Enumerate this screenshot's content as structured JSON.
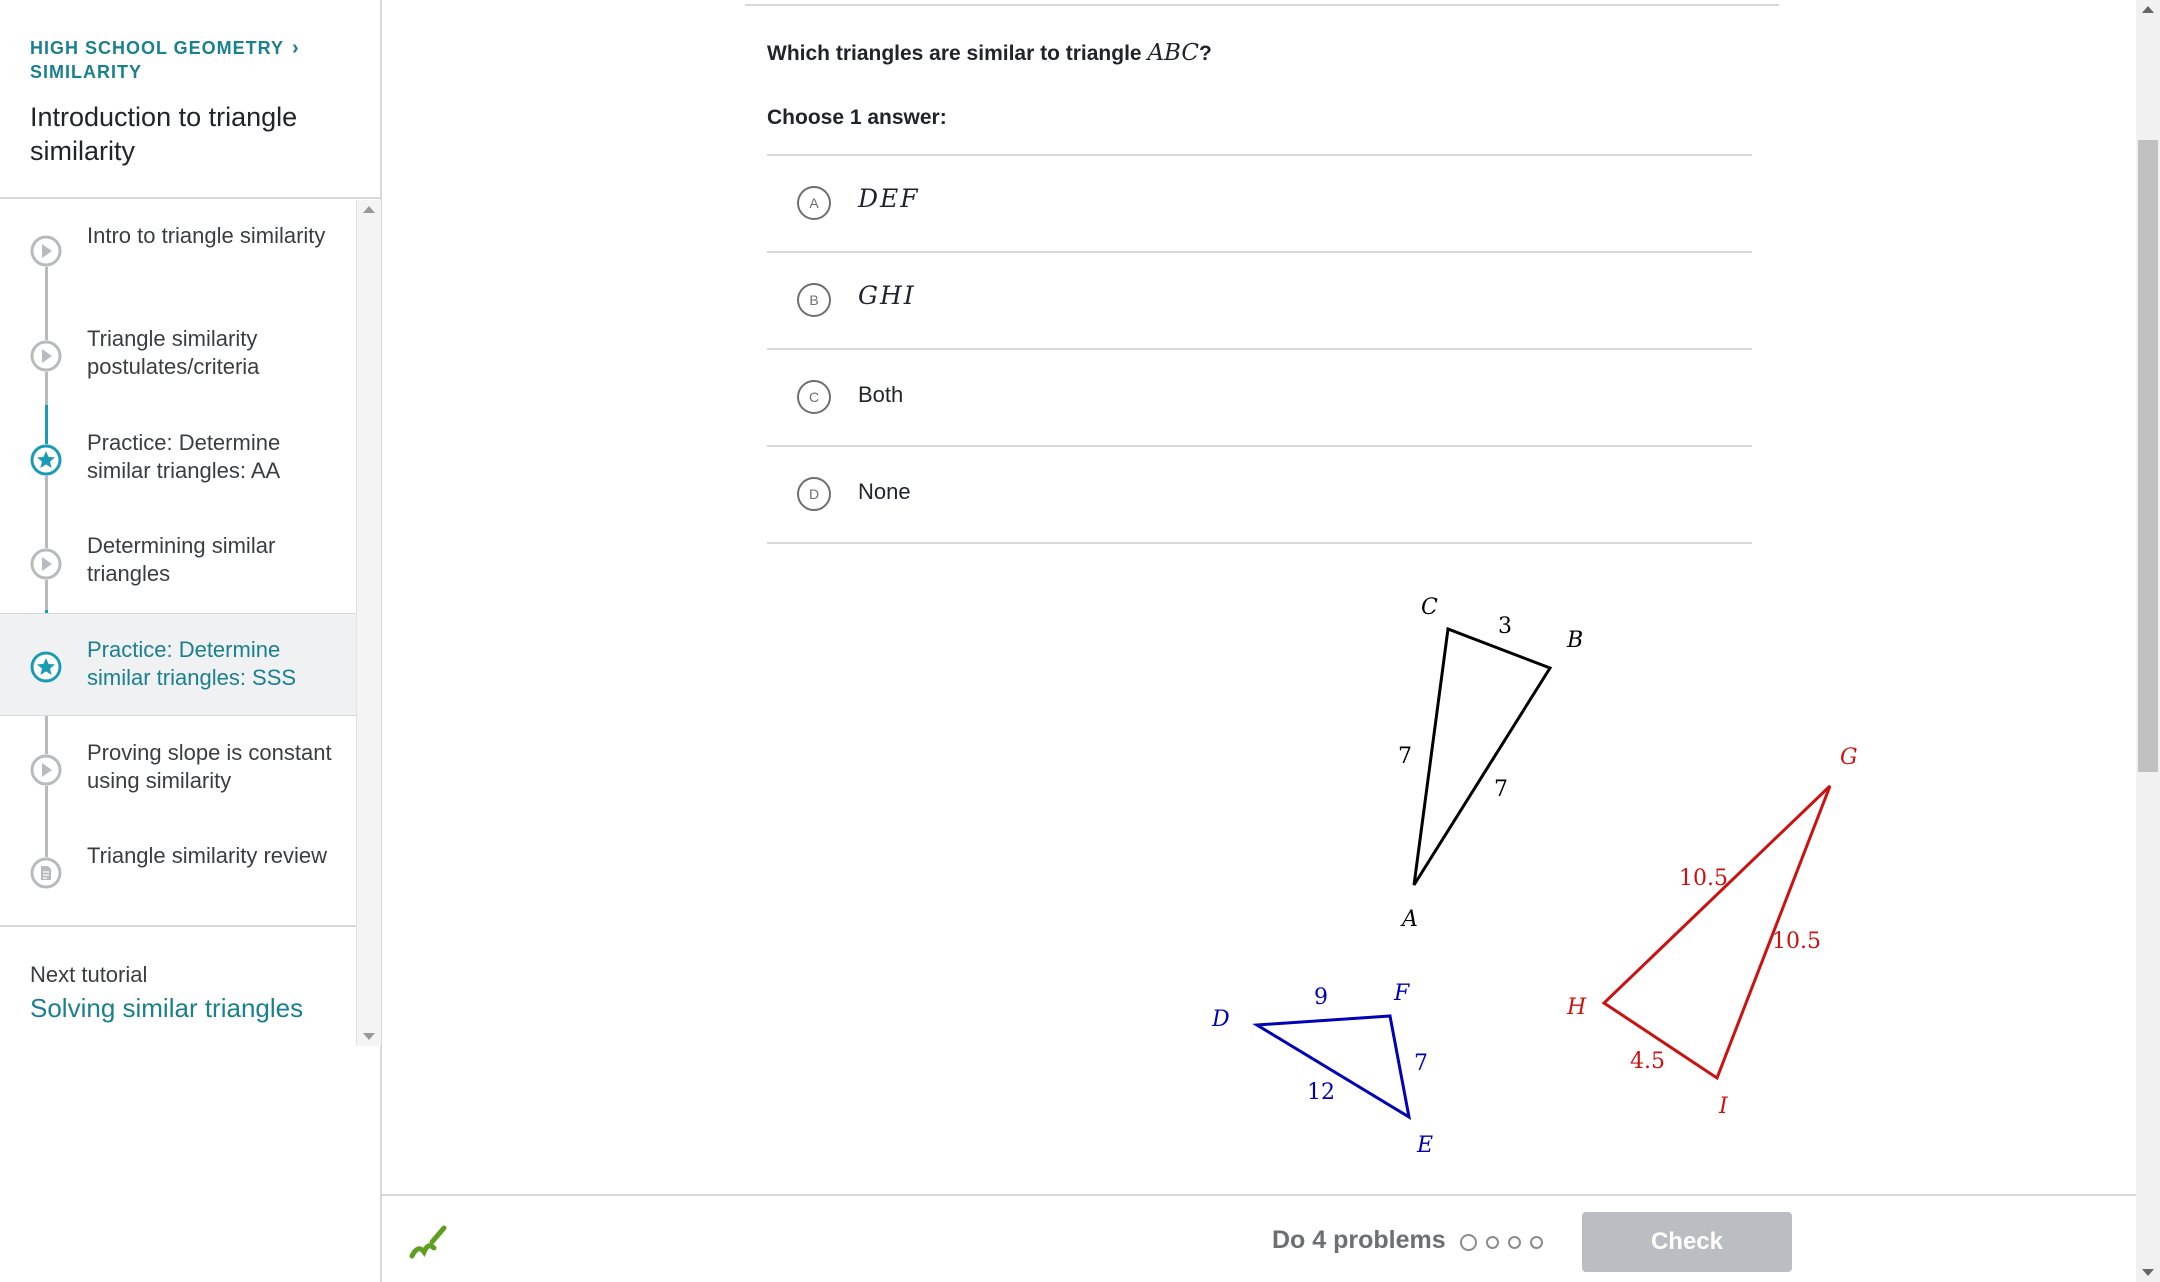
{
  "sidebar": {
    "breadcrumb_course": "HIGH SCHOOL GEOMETRY",
    "breadcrumb_unit": "SIMILARITY",
    "breadcrumb_chevron": "›",
    "title": "Introduction to triangle similarity",
    "items": [
      {
        "label": "Intro to triangle similarity",
        "icon": "play-icon"
      },
      {
        "label": "Triangle similarity postulates/criteria",
        "icon": "play-icon"
      },
      {
        "label": "Practice: Determine similar triangles: AA",
        "icon": "star-icon"
      },
      {
        "label": "Determining similar triangles",
        "icon": "play-icon"
      },
      {
        "label": "Practice: Determine similar triangles: SSS",
        "icon": "star-icon",
        "active": true
      },
      {
        "label": "Proving slope is constant using similarity",
        "icon": "play-icon"
      },
      {
        "label": "Triangle similarity review",
        "icon": "document-icon"
      }
    ],
    "next_label": "Next tutorial",
    "next_link": "Solving similar triangles"
  },
  "question": {
    "prompt": "Which triangles are similar to triangle ",
    "prompt_math": "ABC",
    "prompt_end": "?",
    "choose": "Choose 1 answer:",
    "answers": [
      {
        "letter": "A",
        "text": "DEF",
        "math": true
      },
      {
        "letter": "B",
        "text": "GHI",
        "math": true
      },
      {
        "letter": "C",
        "text": "Both",
        "math": false
      },
      {
        "letter": "D",
        "text": "None",
        "math": false
      }
    ]
  },
  "figure": {
    "abc": {
      "color": "#000000",
      "vertices": [
        "A",
        "B",
        "C"
      ],
      "sides": {
        "AC": "7",
        "CB": "3",
        "AB": "7"
      }
    },
    "def": {
      "color": "#0000b8",
      "vertices": [
        "D",
        "E",
        "F"
      ],
      "sides": {
        "DF": "9",
        "FE": "7",
        "DE": "12"
      }
    },
    "ghi": {
      "color": "#cc1111",
      "vertices": [
        "G",
        "H",
        "I"
      ],
      "sides": {
        "HG": "10.5",
        "GI": "10.5",
        "HI": "4.5"
      }
    }
  },
  "footer": {
    "do_problems": "Do 4 problems",
    "check": "Check",
    "scratchpad_icon": "pencil-icon",
    "progress_dots": 4
  },
  "colors": {
    "accent": "#1a7f8e",
    "check_disabled": "#babec2",
    "scratchpad": "#5f9e1f"
  }
}
